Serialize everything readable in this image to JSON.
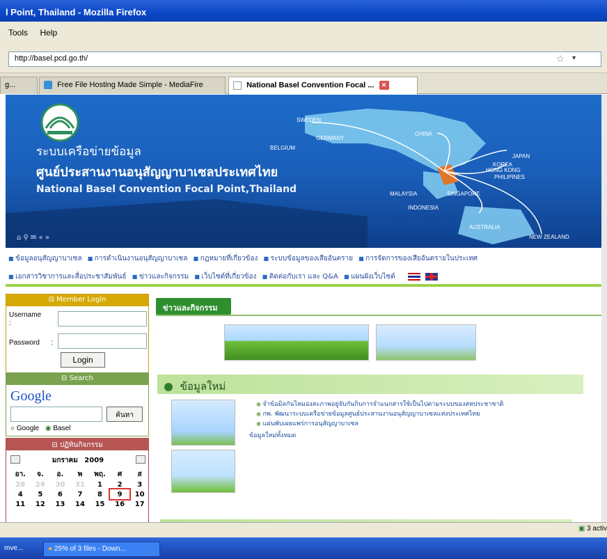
{
  "window": {
    "title": "l Point, Thailand - Mozilla Firefox"
  },
  "menu": {
    "items": [
      "Tools",
      "Help"
    ]
  },
  "nav": {
    "url": "http://basel.pcd.go.th/"
  },
  "tabs": [
    {
      "label": "g..."
    },
    {
      "label": "Free File Hosting Made Simple - MediaFire"
    },
    {
      "label": "National Basel Convention Focal ..."
    }
  ],
  "banner": {
    "line1": "ระบบเครือข่ายข้อมูล",
    "line2": "ศูนย์ประสานงานอนุสัญญาบาเซลประเทศไทย",
    "line3": "National Basel Convention Focal Point,Thailand",
    "countries": [
      "SWEDEN",
      "GERMANY",
      "BELGIUM",
      "CHINA",
      "JAPAN",
      "KOREA",
      "HONG KONG",
      "PHILIPINES",
      "MALAYSIA",
      "SINGAPORE",
      "INDONESIA",
      "AUSTRALIA",
      "NEW ZEALAND"
    ]
  },
  "topnav": {
    "row1": [
      "ข้อมูลอนุสัญญาบาเซล",
      "การดำเนินงานอนุสัญญาบาเซล",
      "กฎหมายที่เกี่ยวข้อง",
      "ระบบข้อมูลของเสียอันตราย",
      "การจัดการของเสียอันตรายในประเทศ"
    ],
    "row2": [
      "เอกสารวิชาการและสื่อประชาสัมพันธ์",
      "ข่าวและกิจกรรม",
      "เว็บไซต์ที่เกี่ยวข้อง",
      "ติดต่อกับเรา และ Q&A",
      "แผนผังเว็บไซต์"
    ]
  },
  "login": {
    "header": "Member Login",
    "username_label": "Username",
    "colon": ":",
    "password_label": "Password",
    "password_colon": ":",
    "button": "Login"
  },
  "search": {
    "header": "Search",
    "logo": "Google",
    "button": "ค้นหา",
    "option1": "Google",
    "option2": "Basel",
    "selected": "Basel"
  },
  "calendar": {
    "header": "ปฏิทินกิจกรรม",
    "month": "มกราคม",
    "year": "2009",
    "weekdays": [
      "อา.",
      "จ.",
      "อ.",
      "พ",
      "พฤ.",
      "ศ",
      "ส"
    ],
    "weeks": [
      [
        "28",
        "29",
        "30",
        "31",
        "1",
        "2",
        "3"
      ],
      [
        "4",
        "5",
        "6",
        "7",
        "8",
        "9",
        "10"
      ],
      [
        "11",
        "12",
        "13",
        "14",
        "15",
        "16",
        "17"
      ]
    ],
    "today": "9"
  },
  "main": {
    "news_tab": "ข่าวและกิจกรรม",
    "new_info_header": "ข้อมูลใหม่",
    "news": [
      "จำข้อมิลกันไหมอ่งสะภาพอยู่จับกันกิบการจำแนกสารใช้เป็นไปตามระบบของสหประชาชาติ",
      "กพ. พัฒนาระบบเครือข่ายข้อมูลศูนย์ประสานงานอนุสัญญาบาเซลแห่งประเทศไทย",
      "แผ่นพับเผยแพร่การอนุสัญญาบาเซล"
    ],
    "more": "ข้อมูลใหม่ทั้งหมด"
  },
  "status": {
    "right": "3 activ"
  },
  "taskbar": {
    "item1": "mve...",
    "item2": "25% of 3 files - Down..."
  }
}
